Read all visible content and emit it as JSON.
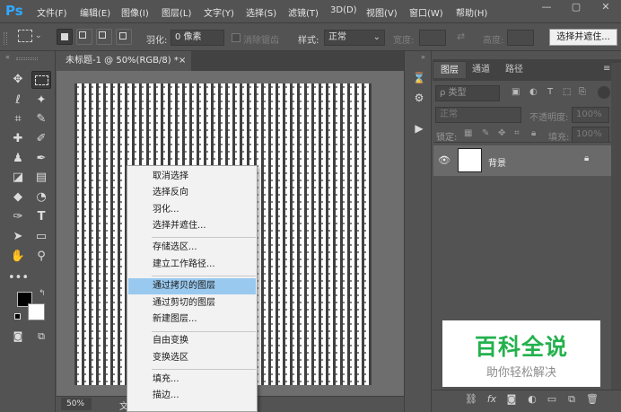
{
  "app": {
    "logo": "Ps",
    "menus": [
      "文件(F)",
      "编辑(E)",
      "图像(I)",
      "图层(L)",
      "文字(Y)",
      "选择(S)",
      "滤镜(T)",
      "3D(D)",
      "视图(V)",
      "窗口(W)",
      "帮助(H)"
    ],
    "window_buttons": [
      "—",
      "▢",
      "✕"
    ]
  },
  "options_bar": {
    "feather_label": "羽化:",
    "feather_value": "0 像素",
    "antialias_label": "消除锯齿",
    "style_label": "样式:",
    "style_value": "正常",
    "width_label": "宽度:",
    "height_label": "高度:",
    "swap_symbol": "⇄",
    "select_mask_button": "选择并遮住..."
  },
  "document": {
    "tab_title": "未标题-1 @ 50%(RGB/8) *",
    "tab_close": "×",
    "zoom": "50%",
    "status_partial": "文"
  },
  "context_menu": {
    "items": [
      "取消选择",
      "选择反向",
      "羽化...",
      "选择并遮住...",
      "存储选区...",
      "建立工作路径...",
      "通过拷贝的图层",
      "通过剪切的图层",
      "新建图层...",
      "自由变换",
      "变换选区",
      "填充...",
      "描边..."
    ],
    "highlighted_item": "通过拷贝的图层"
  },
  "layers_panel": {
    "tabs": [
      "图层",
      "通道",
      "路径"
    ],
    "active_tab": "图层",
    "filter_label": "ρ 类型",
    "blend_mode": "正常",
    "opacity_label": "不透明度:",
    "opacity_value": "100%",
    "lock_label": "锁定:",
    "fill_label": "填充:",
    "fill_value": "100%",
    "layer_name": "背景",
    "bottom_icons": [
      "link-icon",
      "fx-icon",
      "mask-icon",
      "adjustment-icon",
      "group-icon",
      "new-layer-icon",
      "trash-icon"
    ],
    "fx_text": "fx"
  },
  "watermark": {
    "title": "百科全说",
    "subtitle": "助你轻松解决"
  },
  "colors": {
    "ui_dark": "#535353",
    "brand_blue": "#31a8ff",
    "menu_highlight": "#99c9ef",
    "watermark_green": "#23b14d"
  }
}
